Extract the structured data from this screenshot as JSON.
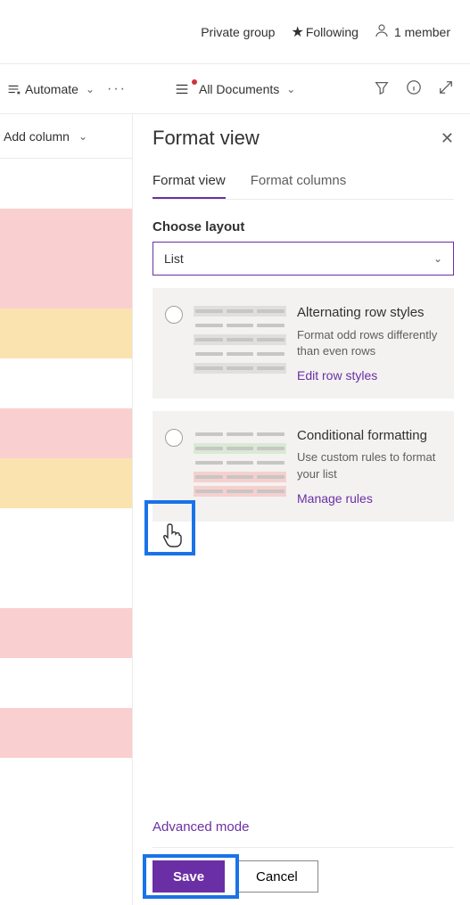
{
  "header": {
    "group_type": "Private group",
    "following": "Following",
    "members": "1 member"
  },
  "commandbar": {
    "automate": "Automate",
    "view_name": "All Documents"
  },
  "left": {
    "add_column": "Add column"
  },
  "panel": {
    "title": "Format view",
    "tabs": {
      "format_view": "Format view",
      "format_columns": "Format columns"
    },
    "choose_layout_label": "Choose layout",
    "layout_value": "List",
    "cards": {
      "alternating": {
        "title": "Alternating row styles",
        "desc": "Format odd rows differently than even rows",
        "link": "Edit row styles"
      },
      "conditional": {
        "title": "Conditional formatting",
        "desc": "Use custom rules to format your list",
        "link": "Manage rules"
      }
    },
    "advanced": "Advanced mode",
    "save": "Save",
    "cancel": "Cancel"
  }
}
